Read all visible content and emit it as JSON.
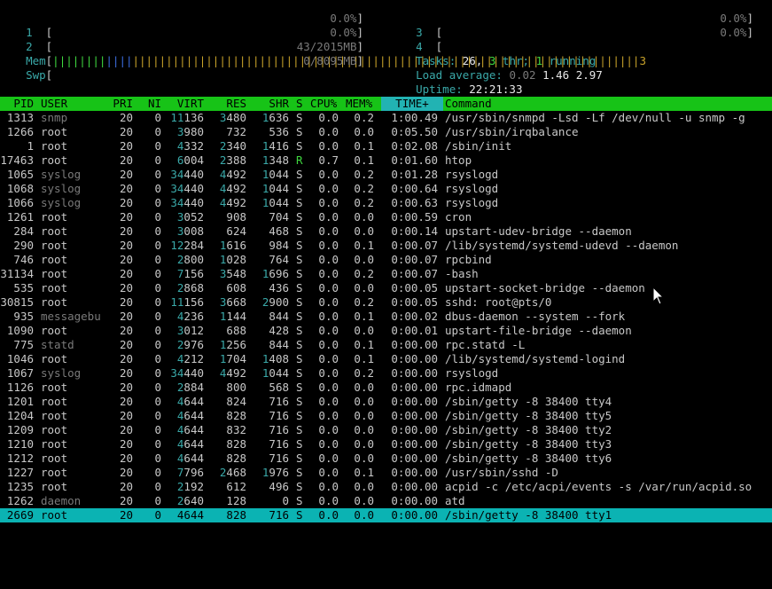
{
  "cpus": [
    {
      "num": "1",
      "pct": "0.0%"
    },
    {
      "num": "2",
      "pct": "0.0%"
    },
    {
      "num": "3",
      "pct": "0.0%"
    },
    {
      "num": "4",
      "pct": "0.0%"
    }
  ],
  "mem": {
    "label": "Mem",
    "bars_green": "||||||||",
    "bars_blue": "||||",
    "bars_yellow": "||||||||||||||||||||||||||||||||||||||||||||||||||||||||||||||||||||||||||||3",
    "value": "43/2015MB"
  },
  "swp": {
    "label": "Swp",
    "value": "0/8095MB"
  },
  "tasks": {
    "label": "Tasks:",
    "count": "26,",
    "thr": "3",
    "thr_label": "thr;",
    "running": "1",
    "running_label": "running"
  },
  "load": {
    "label": "Load average:",
    "l1": "0.02",
    "l5": "1.46",
    "l15": "2.97"
  },
  "uptime": {
    "label": "Uptime:",
    "value": "22:21:33"
  },
  "columns": {
    "pid": "PID",
    "user": "USER",
    "pri": "PRI",
    "ni": "NI",
    "virt": "VIRT",
    "res": "RES",
    "shr": "SHR",
    "s": "S",
    "cpu": "CPU%",
    "mem": "MEM%",
    "time": "TIME+",
    "cmd": "Command"
  },
  "processes": [
    {
      "pid": "1313",
      "user": "snmp",
      "pri": "20",
      "ni": "0",
      "virt": "11136",
      "res": "3480",
      "shr": "1636",
      "s": "S",
      "cpu": "0.0",
      "mem": "0.2",
      "time": "1:00.49",
      "cmd": "/usr/sbin/snmpd -Lsd -Lf /dev/null -u snmp -g"
    },
    {
      "pid": "1266",
      "user": "root",
      "pri": "20",
      "ni": "0",
      "virt": "3980",
      "res": "732",
      "shr": "536",
      "s": "S",
      "cpu": "0.0",
      "mem": "0.0",
      "time": "0:05.50",
      "cmd": "/usr/sbin/irqbalance"
    },
    {
      "pid": "1",
      "user": "root",
      "pri": "20",
      "ni": "0",
      "virt": "4332",
      "res": "2340",
      "shr": "1416",
      "s": "S",
      "cpu": "0.0",
      "mem": "0.1",
      "time": "0:02.08",
      "cmd": "/sbin/init"
    },
    {
      "pid": "17463",
      "user": "root",
      "pri": "20",
      "ni": "0",
      "virt": "6004",
      "res": "2388",
      "shr": "1348",
      "s": "R",
      "cpu": "0.7",
      "mem": "0.1",
      "time": "0:01.60",
      "cmd": "htop"
    },
    {
      "pid": "1065",
      "user": "syslog",
      "pri": "20",
      "ni": "0",
      "virt": "34440",
      "res": "4492",
      "shr": "1044",
      "s": "S",
      "cpu": "0.0",
      "mem": "0.2",
      "time": "0:01.28",
      "cmd": "rsyslogd"
    },
    {
      "pid": "1068",
      "user": "syslog",
      "pri": "20",
      "ni": "0",
      "virt": "34440",
      "res": "4492",
      "shr": "1044",
      "s": "S",
      "cpu": "0.0",
      "mem": "0.2",
      "time": "0:00.64",
      "cmd": "rsyslogd"
    },
    {
      "pid": "1066",
      "user": "syslog",
      "pri": "20",
      "ni": "0",
      "virt": "34440",
      "res": "4492",
      "shr": "1044",
      "s": "S",
      "cpu": "0.0",
      "mem": "0.2",
      "time": "0:00.63",
      "cmd": "rsyslogd"
    },
    {
      "pid": "1261",
      "user": "root",
      "pri": "20",
      "ni": "0",
      "virt": "3052",
      "res": "908",
      "shr": "704",
      "s": "S",
      "cpu": "0.0",
      "mem": "0.0",
      "time": "0:00.59",
      "cmd": "cron"
    },
    {
      "pid": "284",
      "user": "root",
      "pri": "20",
      "ni": "0",
      "virt": "3008",
      "res": "624",
      "shr": "468",
      "s": "S",
      "cpu": "0.0",
      "mem": "0.0",
      "time": "0:00.14",
      "cmd": "upstart-udev-bridge --daemon"
    },
    {
      "pid": "290",
      "user": "root",
      "pri": "20",
      "ni": "0",
      "virt": "12284",
      "res": "1616",
      "shr": "984",
      "s": "S",
      "cpu": "0.0",
      "mem": "0.1",
      "time": "0:00.07",
      "cmd": "/lib/systemd/systemd-udevd --daemon"
    },
    {
      "pid": "746",
      "user": "root",
      "pri": "20",
      "ni": "0",
      "virt": "2800",
      "res": "1028",
      "shr": "764",
      "s": "S",
      "cpu": "0.0",
      "mem": "0.0",
      "time": "0:00.07",
      "cmd": "rpcbind"
    },
    {
      "pid": "31134",
      "user": "root",
      "pri": "20",
      "ni": "0",
      "virt": "7156",
      "res": "3548",
      "shr": "1696",
      "s": "S",
      "cpu": "0.0",
      "mem": "0.2",
      "time": "0:00.07",
      "cmd": "-bash"
    },
    {
      "pid": "535",
      "user": "root",
      "pri": "20",
      "ni": "0",
      "virt": "2868",
      "res": "608",
      "shr": "436",
      "s": "S",
      "cpu": "0.0",
      "mem": "0.0",
      "time": "0:00.05",
      "cmd": "upstart-socket-bridge --daemon"
    },
    {
      "pid": "30815",
      "user": "root",
      "pri": "20",
      "ni": "0",
      "virt": "11156",
      "res": "3668",
      "shr": "2900",
      "s": "S",
      "cpu": "0.0",
      "mem": "0.2",
      "time": "0:00.05",
      "cmd": "sshd: root@pts/0"
    },
    {
      "pid": "935",
      "user": "messagebu",
      "pri": "20",
      "ni": "0",
      "virt": "4236",
      "res": "1144",
      "shr": "844",
      "s": "S",
      "cpu": "0.0",
      "mem": "0.1",
      "time": "0:00.02",
      "cmd": "dbus-daemon --system --fork"
    },
    {
      "pid": "1090",
      "user": "root",
      "pri": "20",
      "ni": "0",
      "virt": "3012",
      "res": "688",
      "shr": "428",
      "s": "S",
      "cpu": "0.0",
      "mem": "0.0",
      "time": "0:00.01",
      "cmd": "upstart-file-bridge --daemon"
    },
    {
      "pid": "775",
      "user": "statd",
      "pri": "20",
      "ni": "0",
      "virt": "2976",
      "res": "1256",
      "shr": "844",
      "s": "S",
      "cpu": "0.0",
      "mem": "0.1",
      "time": "0:00.00",
      "cmd": "rpc.statd -L"
    },
    {
      "pid": "1046",
      "user": "root",
      "pri": "20",
      "ni": "0",
      "virt": "4212",
      "res": "1704",
      "shr": "1408",
      "s": "S",
      "cpu": "0.0",
      "mem": "0.1",
      "time": "0:00.00",
      "cmd": "/lib/systemd/systemd-logind"
    },
    {
      "pid": "1067",
      "user": "syslog",
      "pri": "20",
      "ni": "0",
      "virt": "34440",
      "res": "4492",
      "shr": "1044",
      "s": "S",
      "cpu": "0.0",
      "mem": "0.2",
      "time": "0:00.00",
      "cmd": "rsyslogd"
    },
    {
      "pid": "1126",
      "user": "root",
      "pri": "20",
      "ni": "0",
      "virt": "2884",
      "res": "800",
      "shr": "568",
      "s": "S",
      "cpu": "0.0",
      "mem": "0.0",
      "time": "0:00.00",
      "cmd": "rpc.idmapd"
    },
    {
      "pid": "1201",
      "user": "root",
      "pri": "20",
      "ni": "0",
      "virt": "4644",
      "res": "824",
      "shr": "716",
      "s": "S",
      "cpu": "0.0",
      "mem": "0.0",
      "time": "0:00.00",
      "cmd": "/sbin/getty -8 38400 tty4"
    },
    {
      "pid": "1204",
      "user": "root",
      "pri": "20",
      "ni": "0",
      "virt": "4644",
      "res": "828",
      "shr": "716",
      "s": "S",
      "cpu": "0.0",
      "mem": "0.0",
      "time": "0:00.00",
      "cmd": "/sbin/getty -8 38400 tty5"
    },
    {
      "pid": "1209",
      "user": "root",
      "pri": "20",
      "ni": "0",
      "virt": "4644",
      "res": "832",
      "shr": "716",
      "s": "S",
      "cpu": "0.0",
      "mem": "0.0",
      "time": "0:00.00",
      "cmd": "/sbin/getty -8 38400 tty2"
    },
    {
      "pid": "1210",
      "user": "root",
      "pri": "20",
      "ni": "0",
      "virt": "4644",
      "res": "828",
      "shr": "716",
      "s": "S",
      "cpu": "0.0",
      "mem": "0.0",
      "time": "0:00.00",
      "cmd": "/sbin/getty -8 38400 tty3"
    },
    {
      "pid": "1212",
      "user": "root",
      "pri": "20",
      "ni": "0",
      "virt": "4644",
      "res": "828",
      "shr": "716",
      "s": "S",
      "cpu": "0.0",
      "mem": "0.0",
      "time": "0:00.00",
      "cmd": "/sbin/getty -8 38400 tty6"
    },
    {
      "pid": "1227",
      "user": "root",
      "pri": "20",
      "ni": "0",
      "virt": "7796",
      "res": "2468",
      "shr": "1976",
      "s": "S",
      "cpu": "0.0",
      "mem": "0.1",
      "time": "0:00.00",
      "cmd": "/usr/sbin/sshd -D"
    },
    {
      "pid": "1235",
      "user": "root",
      "pri": "20",
      "ni": "0",
      "virt": "2192",
      "res": "612",
      "shr": "496",
      "s": "S",
      "cpu": "0.0",
      "mem": "0.0",
      "time": "0:00.00",
      "cmd": "acpid -c /etc/acpi/events -s /var/run/acpid.so"
    },
    {
      "pid": "1262",
      "user": "daemon",
      "pri": "20",
      "ni": "0",
      "virt": "2640",
      "res": "128",
      "shr": "0",
      "s": "S",
      "cpu": "0.0",
      "mem": "0.0",
      "time": "0:00.00",
      "cmd": "atd"
    },
    {
      "pid": "2669",
      "user": "root",
      "pri": "20",
      "ni": "0",
      "virt": "4644",
      "res": "828",
      "shr": "716",
      "s": "S",
      "cpu": "0.0",
      "mem": "0.0",
      "time": "0:00.00",
      "cmd": "/sbin/getty -8 38400 tty1",
      "selected": true
    }
  ],
  "colors": {
    "header_bg": "#17c317",
    "sorted_bg": "#22b3b3",
    "selected_bg": "#0bb3b3",
    "label": "#3aa9a9"
  },
  "icons": {
    "cursor": "mouse-pointer-icon"
  }
}
